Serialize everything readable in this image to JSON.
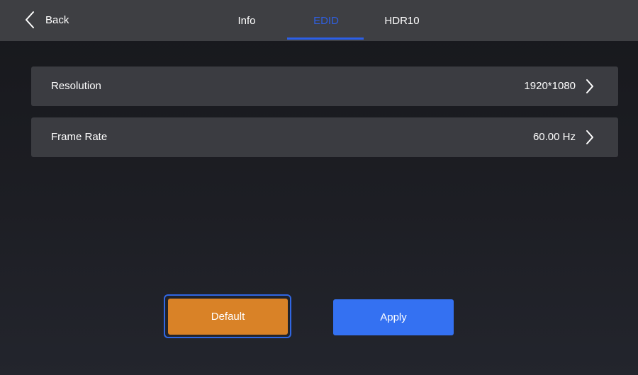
{
  "header": {
    "back_label": "Back",
    "tabs": [
      {
        "label": "Info",
        "active": false
      },
      {
        "label": "EDID",
        "active": true
      },
      {
        "label": "HDR10",
        "active": false
      }
    ],
    "active_color": "#2c5fe8"
  },
  "settings": [
    {
      "label": "Resolution",
      "value": "1920*1080"
    },
    {
      "label": "Frame Rate",
      "value": "60.00 Hz"
    }
  ],
  "actions": {
    "default_label": "Default",
    "apply_label": "Apply",
    "default_color": "#d98227",
    "apply_color": "#3471f2"
  }
}
